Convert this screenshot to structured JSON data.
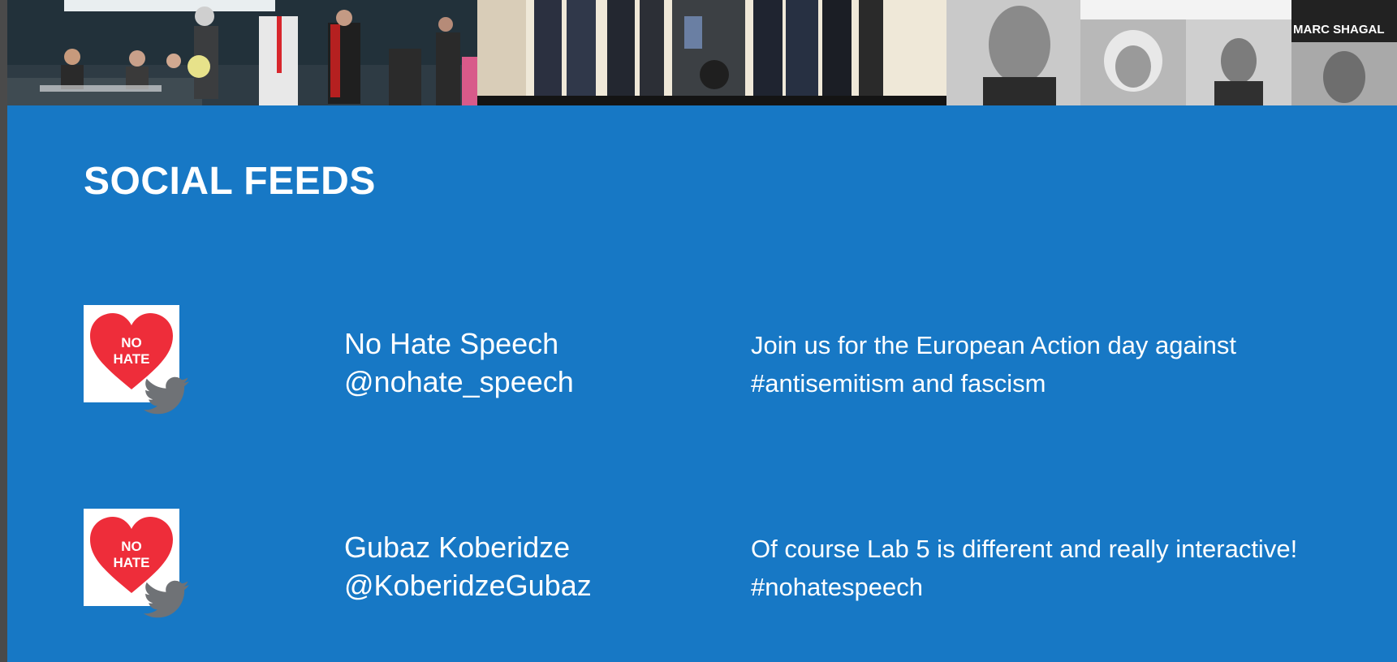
{
  "section": {
    "title": "SOCIAL FEEDS"
  },
  "photos": {
    "caption_3": "MARC SHAGAL"
  },
  "feeds": [
    {
      "avatar_text_1": "NO",
      "avatar_text_2": "HATE",
      "name": "No Hate Speech",
      "handle": "@nohate_speech",
      "text_line_1": "Join us for the European Action day against",
      "text_line_2": "#antisemitism and fascism",
      "icon": "twitter-icon"
    },
    {
      "avatar_text_1": "NO",
      "avatar_text_2": "HATE",
      "name": "Gubaz Koberidze",
      "handle": "@KoberidzeGubaz",
      "text_line_1": "Of course Lab 5 is different and really interactive!",
      "text_line_2": "#nohatespeech",
      "icon": "twitter-icon"
    }
  ],
  "colors": {
    "background": "#1778c5",
    "heart": "#ee2d3a",
    "twitter_badge": "#6f7276",
    "text": "#ffffff"
  }
}
